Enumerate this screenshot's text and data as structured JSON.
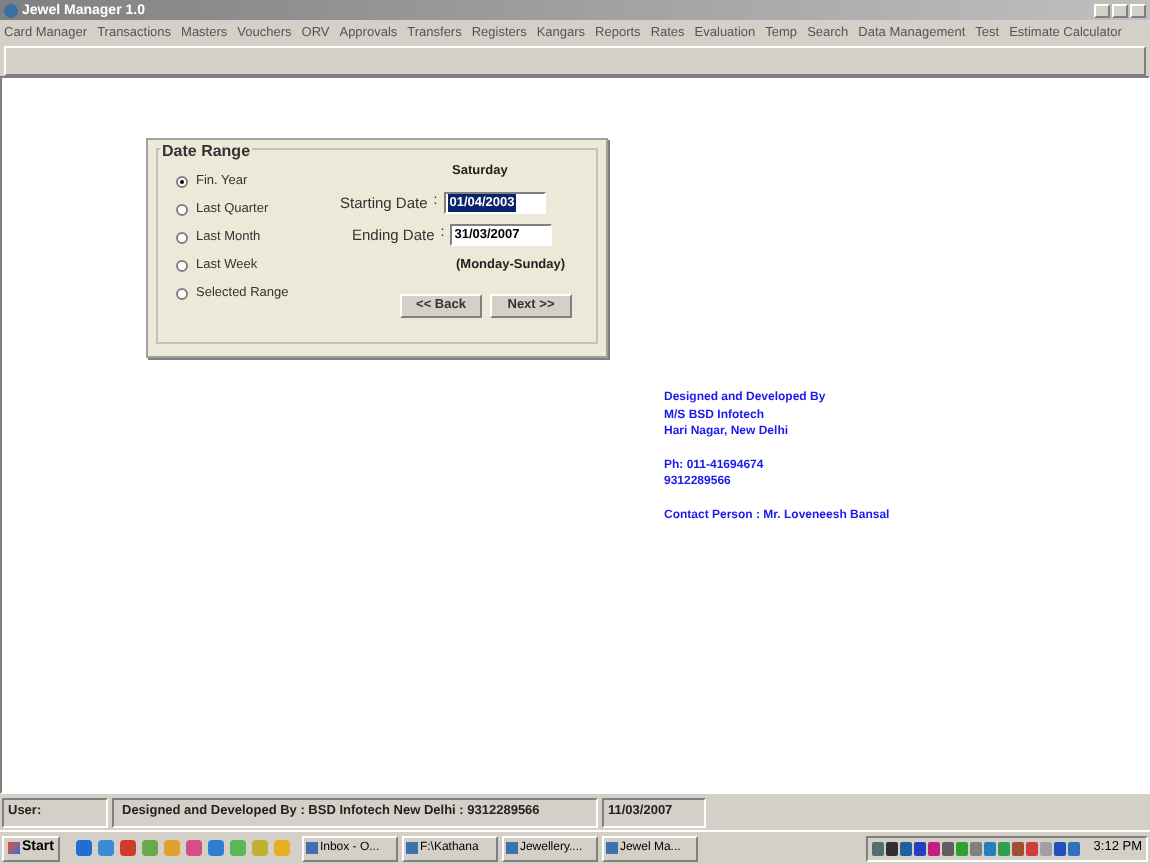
{
  "window": {
    "title": "Jewel Manager 1.0"
  },
  "menu": [
    "Card Manager",
    "Transactions",
    "Masters",
    "Vouchers",
    "ORV",
    "Approvals",
    "Transfers",
    "Registers",
    "Kangars",
    "Reports",
    "Rates",
    "Evaluation",
    "Temp",
    "Search",
    "Data Management",
    "Test",
    "Estimate Calculator"
  ],
  "date_range": {
    "title": "Date Range",
    "options": [
      {
        "label": "Fin. Year",
        "selected": true
      },
      {
        "label": "Last Quarter",
        "selected": false
      },
      {
        "label": "Last Month",
        "selected": false
      },
      {
        "label": "Last Week",
        "selected": false
      },
      {
        "label": "Selected Range",
        "selected": false
      }
    ],
    "day": "Saturday",
    "starting_label": "Starting Date",
    "starting_colon": ":",
    "starting_value": "01/04/2003",
    "ending_label": "Ending Date",
    "ending_colon": ":",
    "ending_value": "31/03/2007",
    "week_note": "(Monday-Sunday)",
    "back": "<< Back",
    "next": "Next >>"
  },
  "credits": [
    [
      "Designed and Developed By",
      "M/S BSD Infotech",
      "Hari Nagar, New Delhi"
    ],
    [
      "Ph: 011-41694674",
      "9312289566"
    ],
    [
      "Contact Person : Mr. Loveneesh Bansal"
    ]
  ],
  "status_bar": [
    "User:",
    "Designed and Developed By : BSD Infotech New Delhi : 9312289566",
    "11/03/2007"
  ],
  "taskbar": {
    "start": "Start",
    "tasks": [
      "Inbox - O...",
      "F:\\Kathana",
      "Jewellery....",
      "Jewel Ma..."
    ],
    "clock": "3:12 PM"
  }
}
